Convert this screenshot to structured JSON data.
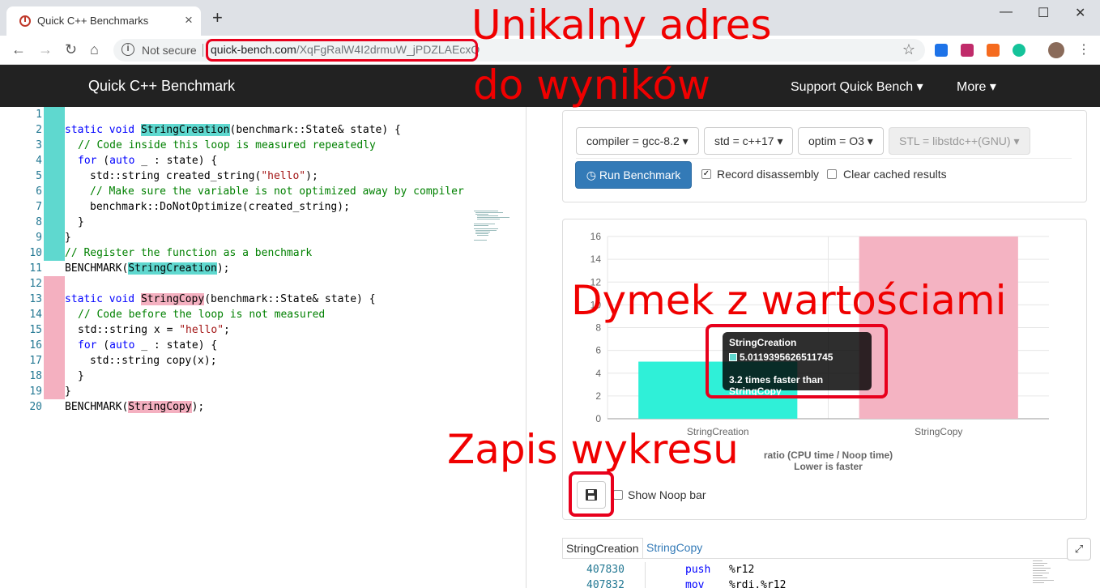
{
  "browser": {
    "tab_title": "Quick C++ Benchmarks",
    "tab_close": "×",
    "new_tab": "+",
    "minimize": "—",
    "maximize": "☐",
    "close": "✕",
    "back": "←",
    "forward": "→",
    "reload": "↻",
    "home": "⌂",
    "info": "i",
    "security_label": "Not secure",
    "url_host": "quick-bench.com",
    "url_path": "/XqFgRalW4I2drmuW_jPDZLAEcxQ",
    "star": "☆",
    "kebab": "⋮"
  },
  "navbar": {
    "brand": "Quick C++ Benchmark",
    "support": "Support Quick Bench ▾",
    "more": "More ▾"
  },
  "editor": {
    "lines": [
      {
        "n": "1"
      },
      {
        "n": "2"
      },
      {
        "n": "3"
      },
      {
        "n": "4"
      },
      {
        "n": "5"
      },
      {
        "n": "6"
      },
      {
        "n": "7"
      },
      {
        "n": "8"
      },
      {
        "n": "9"
      },
      {
        "n": "10"
      },
      {
        "n": "11"
      },
      {
        "n": "12"
      },
      {
        "n": "13"
      },
      {
        "n": "14"
      },
      {
        "n": "15"
      },
      {
        "n": "16"
      },
      {
        "n": "17"
      },
      {
        "n": "18"
      },
      {
        "n": "19"
      },
      {
        "n": "20"
      }
    ],
    "l1": {
      "kw1": "static",
      "kw2": "void",
      "fn": "StringCreation",
      "rest": "(benchmark::State& state) {"
    },
    "l2": "// Code inside this loop is measured repeatedly",
    "l3": {
      "kw": "for",
      "open": " (",
      "kw2": "auto",
      "rest": " _ : state) {"
    },
    "l4": {
      "a": "std::string created_string(",
      "s": "\"hello\"",
      "b": ");"
    },
    "l5": "// Make sure the variable is not optimized away by compiler",
    "l6": "benchmark::DoNotOptimize(created_string);",
    "l7": "}",
    "l8": "}",
    "l9": "// Register the function as a benchmark",
    "l10": {
      "a": "BENCHMARK(",
      "fn": "StringCreation",
      "b": ");"
    },
    "l12": {
      "kw1": "static",
      "kw2": "void",
      "fn": "StringCopy",
      "rest": "(benchmark::State& state) {"
    },
    "l13": "// Code before the loop is not measured",
    "l14": {
      "a": "std::string x = ",
      "s": "\"hello\"",
      "b": ";"
    },
    "l15": {
      "kw": "for",
      "open": " (",
      "kw2": "auto",
      "rest": " _ : state) {"
    },
    "l16": "std::string copy(x);",
    "l17": "}",
    "l18": "}",
    "l19": {
      "a": "BENCHMARK(",
      "fn": "StringCopy",
      "b": ");"
    }
  },
  "options": {
    "compiler": "compiler = gcc-8.2 ▾",
    "std": "std = c++17 ▾",
    "optim": "optim = O3 ▾",
    "stl": "STL = libstdc++(GNU) ▾",
    "run": "Run Benchmark",
    "run_icon": "◷",
    "record_disassembly": "Record disassembly",
    "record_checked": "✓",
    "clear_cache": "Clear cached results"
  },
  "chart_data": {
    "type": "bar",
    "categories": [
      "StringCreation",
      "StringCopy"
    ],
    "values": [
      5.0119395626511745,
      16
    ],
    "colors": [
      "#2ff0d8",
      "#f4b3c2"
    ],
    "ylim": [
      0,
      16
    ],
    "yticks": [
      0,
      2,
      4,
      6,
      8,
      10,
      12,
      14,
      16
    ],
    "xlabel": "ratio (CPU time / Noop time)",
    "xlabel2": "Lower is faster",
    "tooltip": {
      "title": "StringCreation",
      "value": "5.0119395626511745",
      "footer": "3.2 times faster than StringCopy"
    }
  },
  "chart_controls": {
    "save_icon": "💾",
    "show_noop": "Show Noop bar"
  },
  "assembly": {
    "tabs": [
      "StringCreation",
      "StringCopy"
    ],
    "expand": "⤢",
    "rows": [
      {
        "addr": "407830",
        "op": "push",
        "arg": "%r12"
      },
      {
        "addr": "407832",
        "op": "mov",
        "arg": "%rdi,%r12"
      }
    ]
  },
  "annotations": {
    "url_title_1": "Unikalny adres",
    "url_title_2": "do wyników",
    "tooltip_title": "Dymek z wartościami",
    "save_title": "Zapis wykresu",
    "color": "#f00000"
  }
}
